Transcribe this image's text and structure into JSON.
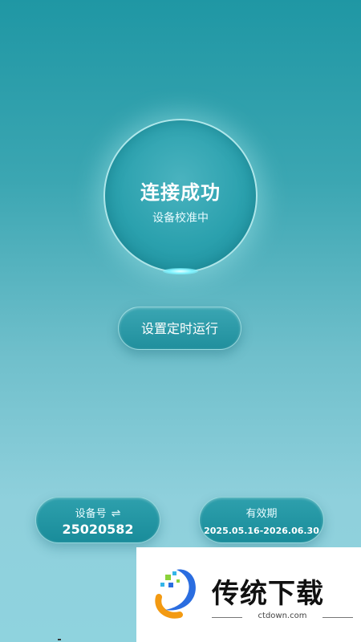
{
  "status": {
    "title": "连接成功",
    "subtitle": "设备校准中"
  },
  "timer_button": {
    "label": "设置定时运行"
  },
  "device_info": {
    "label": "设备号",
    "swap_icon": "⇌",
    "value": "25020582"
  },
  "validity": {
    "label": "有效期",
    "value": "2025.05.16-2026.06.30"
  },
  "watermark": {
    "brand": "传统下载",
    "url": "ctdown.com"
  },
  "colors": {
    "background_top": "#1f97a4",
    "background_bottom": "#8fd3de",
    "accent": "#2ba1ae"
  }
}
